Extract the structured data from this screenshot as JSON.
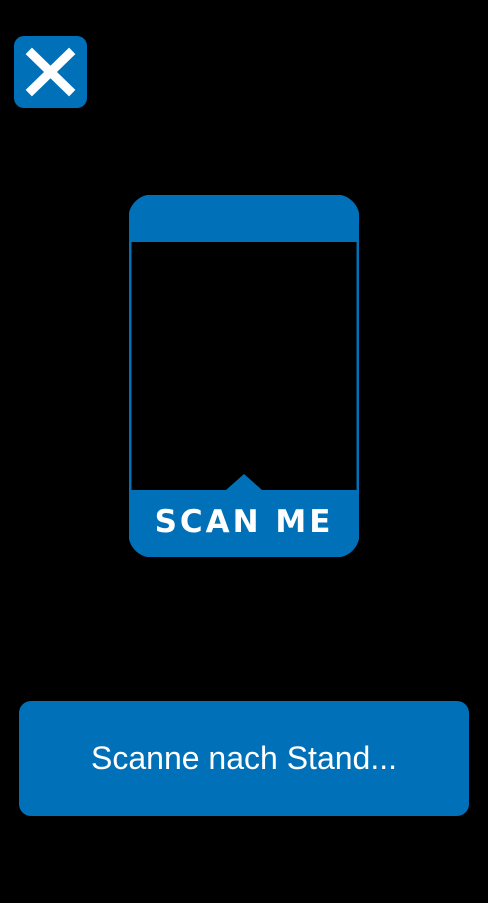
{
  "close_button": {
    "icon": "close-icon"
  },
  "qr_badge": {
    "label": "SCAN ME"
  },
  "status": {
    "text": "Scanne nach Stand..."
  },
  "colors": {
    "accent": "#0070b8",
    "background": "#000000",
    "text": "#ffffff"
  }
}
